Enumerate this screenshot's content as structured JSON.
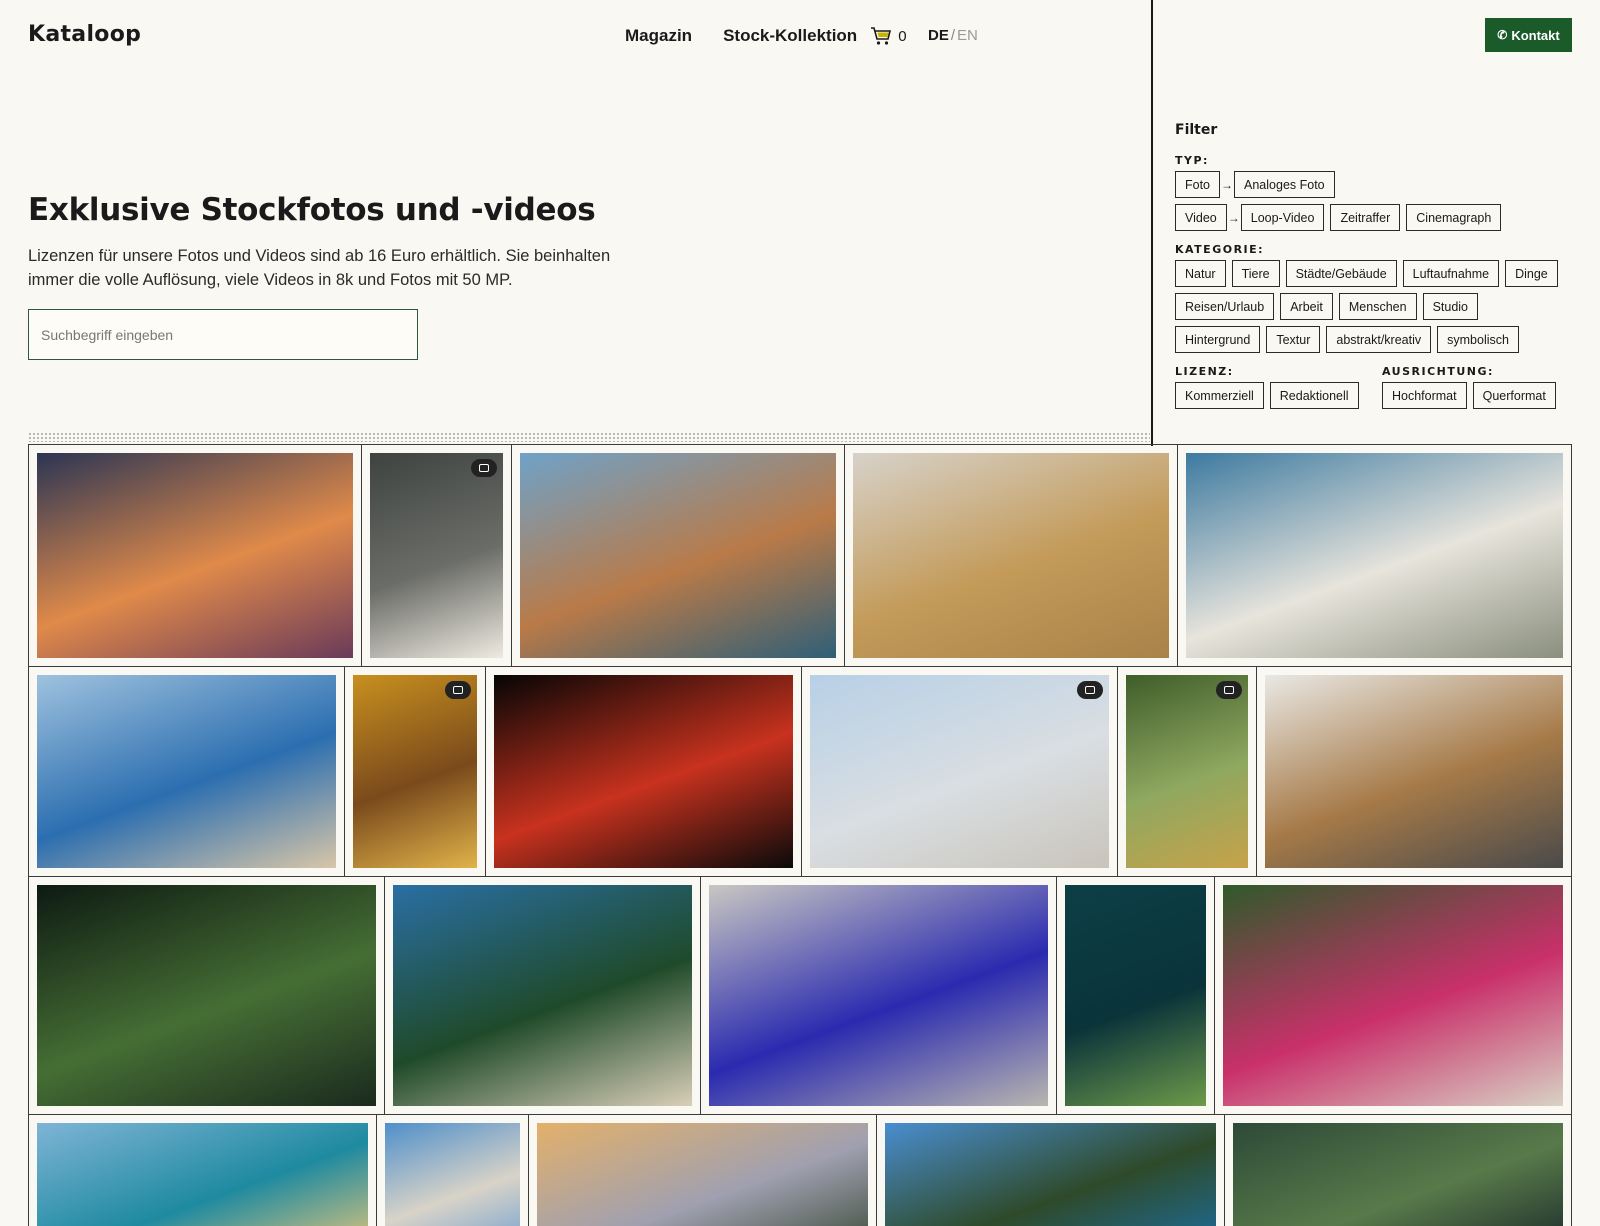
{
  "header": {
    "logo": "Kataloop",
    "nav": [
      {
        "label": "Magazin"
      },
      {
        "label": "Stock-Kollektion"
      }
    ],
    "cart_count": "0",
    "lang_active": "DE",
    "lang_sep": "/",
    "lang_inactive": "EN",
    "contact_label": "Kontakt",
    "contact_icon": "phone-icon"
  },
  "hero": {
    "title": "Exklusive Stockfotos und -videos",
    "subtitle": "Lizenzen für unsere Fotos und Videos sind ab 16 Euro erhältlich. Sie beinhalten immer die volle Auflösung, viele Videos in 8k und Fotos mit 50 MP.",
    "search_placeholder": "Suchbegriff eingeben"
  },
  "filter": {
    "title": "Filter",
    "typ": {
      "heading": "TYP:",
      "row1": [
        "Foto",
        "Analoges Foto"
      ],
      "row2": [
        "Video",
        "Loop-Video",
        "Zeitraffer",
        "Cinemagraph"
      ]
    },
    "kategorie": {
      "heading": "KATEGORIE:",
      "items": [
        "Natur",
        "Tiere",
        "Städte/Gebäude",
        "Luftaufnahme",
        "Dinge",
        "Reisen/Urlaub",
        "Arbeit",
        "Menschen",
        "Studio",
        "Hintergrund",
        "Textur",
        "abstrakt/kreativ",
        "symbolisch"
      ]
    },
    "lizenz": {
      "heading": "LIZENZ:",
      "items": [
        "Kommerziell",
        "Redaktionell"
      ]
    },
    "ausrichtung": {
      "heading": "AUSRICHTUNG:",
      "items": [
        "Hochformat",
        "Querformat"
      ]
    }
  },
  "gallery": {
    "rows": [
      {
        "items": [
          {
            "name": "photo-sunset-clouds-village",
            "badge": false,
            "colors": [
              "#2b3554",
              "#e08a4a",
              "#6a3a5a"
            ]
          },
          {
            "name": "photo-foggy-skyscrapers",
            "badge": true,
            "colors": [
              "#3e4340",
              "#6b6d68",
              "#eeeae0"
            ]
          },
          {
            "name": "photo-bicycle-coast",
            "badge": false,
            "colors": [
              "#6fa2c8",
              "#b97a48",
              "#2f5f78"
            ]
          },
          {
            "name": "photo-sea-foam-sand",
            "badge": false,
            "colors": [
              "#d7d2ca",
              "#c39a58",
              "#a8824a"
            ]
          },
          {
            "name": "photo-aerial-sandbar",
            "badge": false,
            "colors": [
              "#3d7aa0",
              "#e7e4dc",
              "#8a8f7e"
            ]
          }
        ]
      },
      {
        "items": [
          {
            "name": "photo-beach-umbrellas",
            "badge": false,
            "colors": [
              "#9fc2de",
              "#2b6eb0",
              "#d8c6a8"
            ]
          },
          {
            "name": "photo-autumn-birch",
            "badge": true,
            "colors": [
              "#c8901e",
              "#7a4a1c",
              "#e0b34a"
            ]
          },
          {
            "name": "photo-tomatoes-water",
            "badge": false,
            "colors": [
              "#050505",
              "#c8321e",
              "#0a0a0a"
            ]
          },
          {
            "name": "photo-beach-swimmers",
            "badge": true,
            "colors": [
              "#b7d0e6",
              "#d9dee2",
              "#c9c4bb"
            ]
          },
          {
            "name": "photo-green-plant",
            "badge": true,
            "colors": [
              "#3f5d2a",
              "#8fa860",
              "#c7a24a"
            ]
          },
          {
            "name": "photo-notebook-laptop",
            "badge": false,
            "colors": [
              "#e9e8e4",
              "#a67a48",
              "#4a4a4a"
            ]
          }
        ]
      },
      {
        "items": [
          {
            "name": "photo-water-lilies",
            "badge": false,
            "colors": [
              "#0e1a12",
              "#456e34",
              "#1b2a1e"
            ]
          },
          {
            "name": "photo-aerial-island-coast",
            "badge": false,
            "colors": [
              "#2a6fa4",
              "#1f4a2a",
              "#d9cfb8"
            ]
          },
          {
            "name": "photo-rainbow-circle-screen",
            "badge": false,
            "colors": [
              "#c9c7c2",
              "#2a2ab0",
              "#b9b6b0"
            ]
          },
          {
            "name": "photo-kayak-deep-water",
            "badge": false,
            "colors": [
              "#0d3f47",
              "#0a333a",
              "#6d9a4a"
            ]
          },
          {
            "name": "photo-oleander-path",
            "badge": false,
            "colors": [
              "#2f5a2a",
              "#c9306a",
              "#d8d2c4"
            ]
          }
        ]
      },
      {
        "items": [
          {
            "name": "photo-sandy-beach-sea",
            "badge": false,
            "colors": [
              "#7fb4d6",
              "#1e8aa0",
              "#e8c87a"
            ]
          },
          {
            "name": "photo-monument-sky",
            "badge": false,
            "colors": [
              "#4f8fca",
              "#d8d3c8",
              "#6f9ed0"
            ]
          },
          {
            "name": "photo-sunset-coastline",
            "badge": false,
            "colors": [
              "#e3b06a",
              "#a0a0b0",
              "#3a4a38"
            ]
          },
          {
            "name": "photo-pitons-mountain",
            "badge": false,
            "colors": [
              "#4a8ed0",
              "#2e4a2a",
              "#1c6ea0"
            ]
          },
          {
            "name": "photo-peacock",
            "badge": false,
            "colors": [
              "#2d4a38",
              "#587a4a",
              "#1a2a2a"
            ]
          }
        ]
      }
    ]
  }
}
